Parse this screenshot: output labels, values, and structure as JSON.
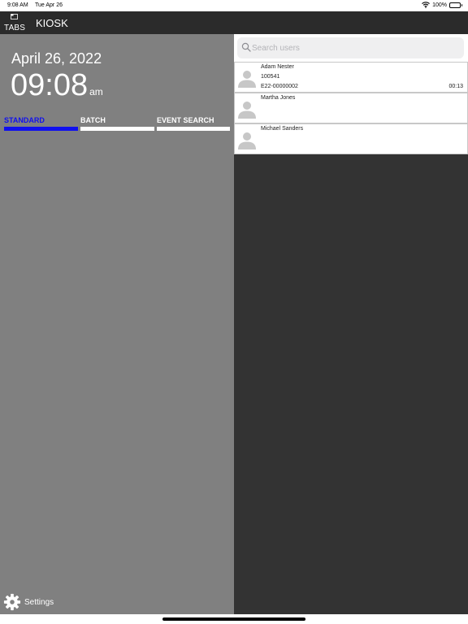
{
  "status_bar": {
    "time": "9:08 AM",
    "date": "Tue Apr 26",
    "battery": "100%",
    "battery_level": 1.0,
    "icons": [
      "wifi-icon",
      "battery-icon"
    ]
  },
  "nav": {
    "tabs_label": "TABS",
    "title": "KIOSK",
    "icons": [
      "tabs-icon"
    ]
  },
  "left": {
    "date": "April 26, 2022",
    "time": "09:08",
    "ampm": "am",
    "segments": [
      {
        "label": "STANDARD",
        "active": true
      },
      {
        "label": "BATCH",
        "active": false
      },
      {
        "label": "EVENT SEARCH",
        "active": false
      }
    ],
    "settings_label": "Settings",
    "settings_icon": "gear-icon"
  },
  "search": {
    "placeholder": "Search users",
    "value": "",
    "icon": "search-icon"
  },
  "users": [
    {
      "name": "Adam Nester",
      "id": "100541",
      "code": "E22-00000002",
      "time": "00:13",
      "avatar_icon": "avatar-placeholder-icon"
    },
    {
      "name": "Martha Jones",
      "id": "",
      "code": "",
      "time": "",
      "avatar_icon": "avatar-placeholder-icon"
    },
    {
      "name": "Michael Sanders",
      "id": "",
      "code": "",
      "time": "",
      "avatar_icon": "avatar-placeholder-icon"
    }
  ],
  "colors": {
    "nav_bg": "#2b2b2b",
    "left_bg": "#808080",
    "right_bg": "#333333",
    "accent": "#1010ee",
    "inactive_bar": "#ffffff"
  }
}
